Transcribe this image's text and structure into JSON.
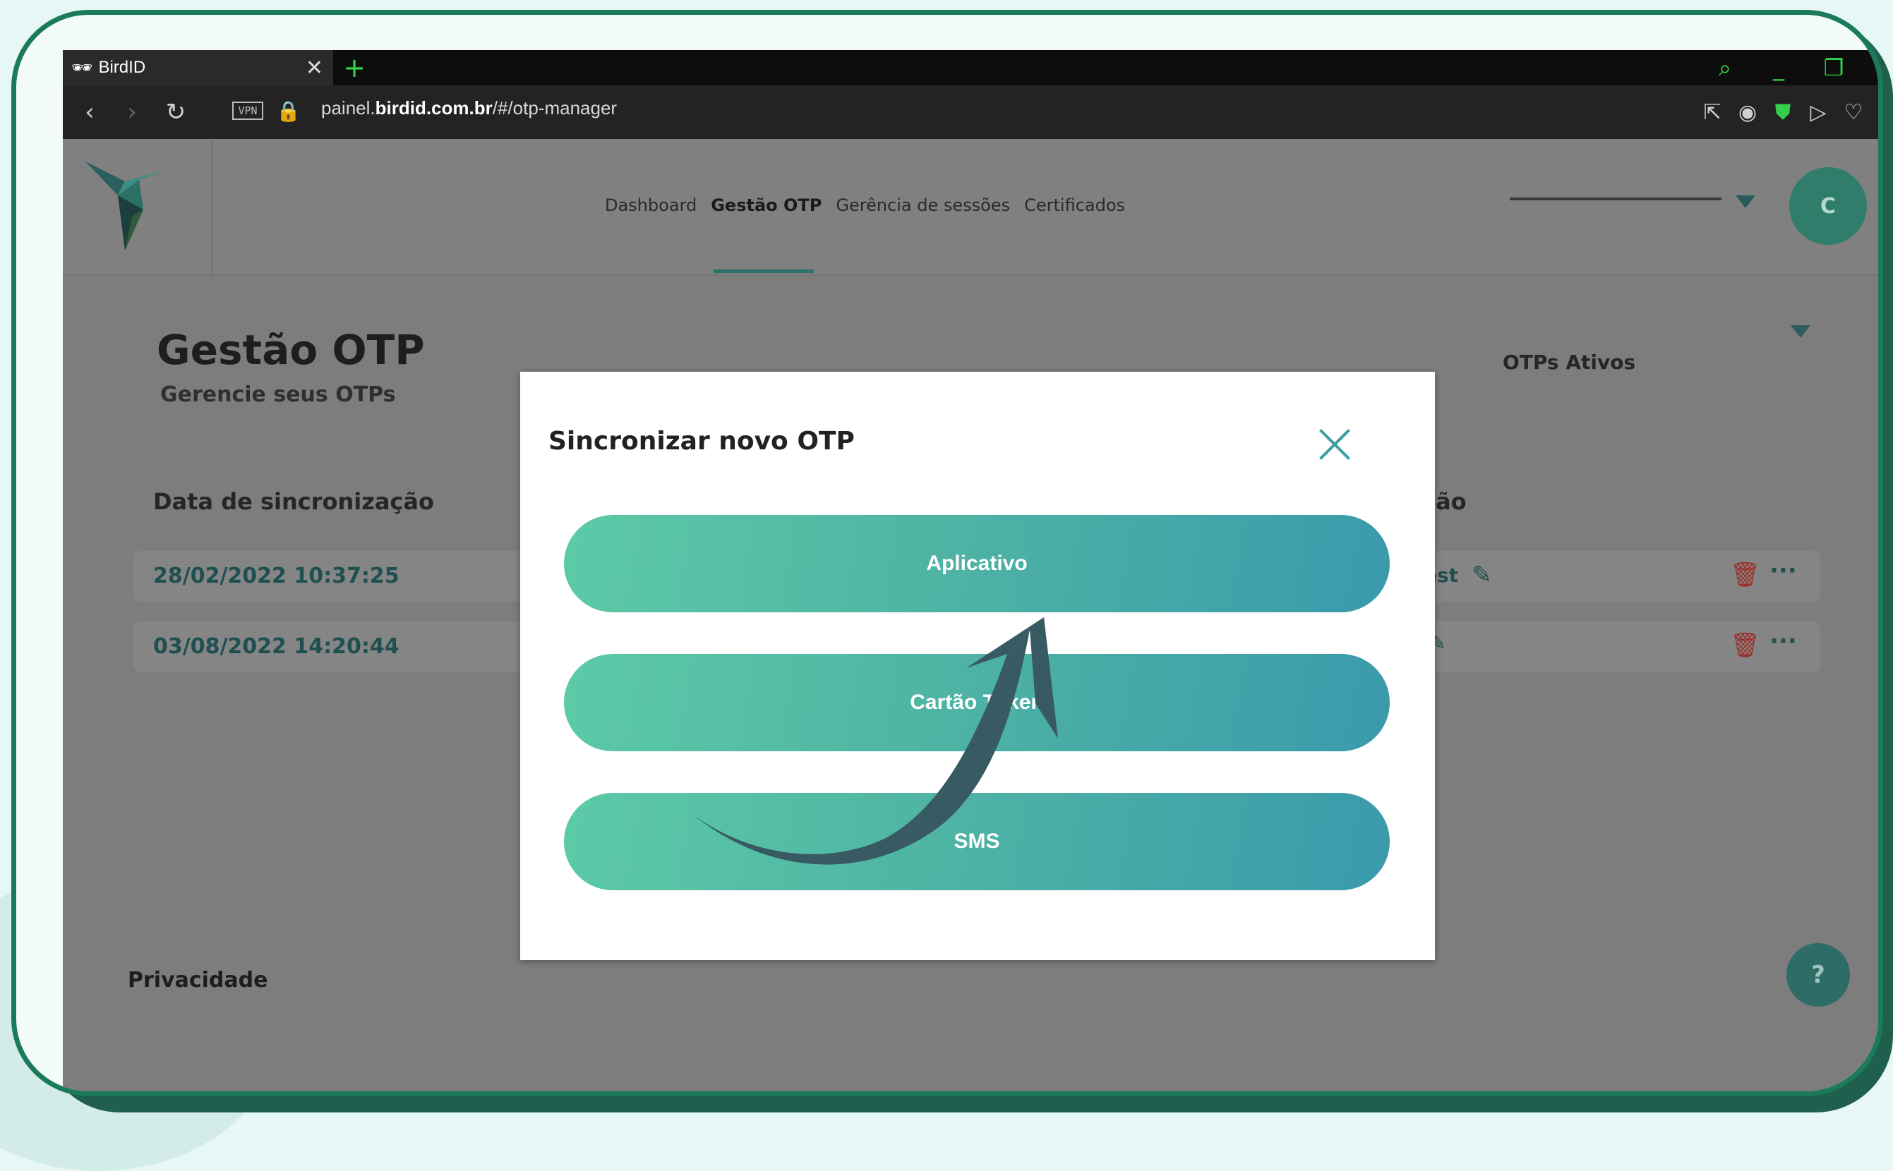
{
  "browser": {
    "tab_title": "BirdID",
    "new_tab": "+",
    "url_prefix": "painel.",
    "url_domain": "birdid.com.br",
    "url_path": "/#/otp-manager",
    "vpn_label": "VPN"
  },
  "header": {
    "nav": [
      "Dashboard",
      "Gestão OTP",
      "Gerência de sessões",
      "Certificados"
    ],
    "active_nav": "Gestão OTP",
    "avatar_initial": "C"
  },
  "main": {
    "title": "Gestão OTP",
    "subtitle": "Gerencie seus OTPs",
    "filter_label": "OTPs Ativos",
    "column_date": "Data de sincronização",
    "column_description_partial": "ção",
    "rows": [
      {
        "date": "28/02/2022 10:37:25",
        "name_partial": "est"
      },
      {
        "date": "03/08/2022 14:20:44",
        "name_partial": ""
      }
    ],
    "footer_privacy": "Privacidade",
    "help_label": "?"
  },
  "modal": {
    "title": "Sincronizar novo OTP",
    "options": [
      "Aplicativo",
      "Cartão Token",
      "SMS"
    ]
  },
  "colors": {
    "accent": "#3a9ea1",
    "button_gradient_start": "#5ccaa7",
    "button_gradient_end": "#3a9aac",
    "annotation_arrow": "#385a62",
    "frame_border": "#1a7a5a"
  }
}
